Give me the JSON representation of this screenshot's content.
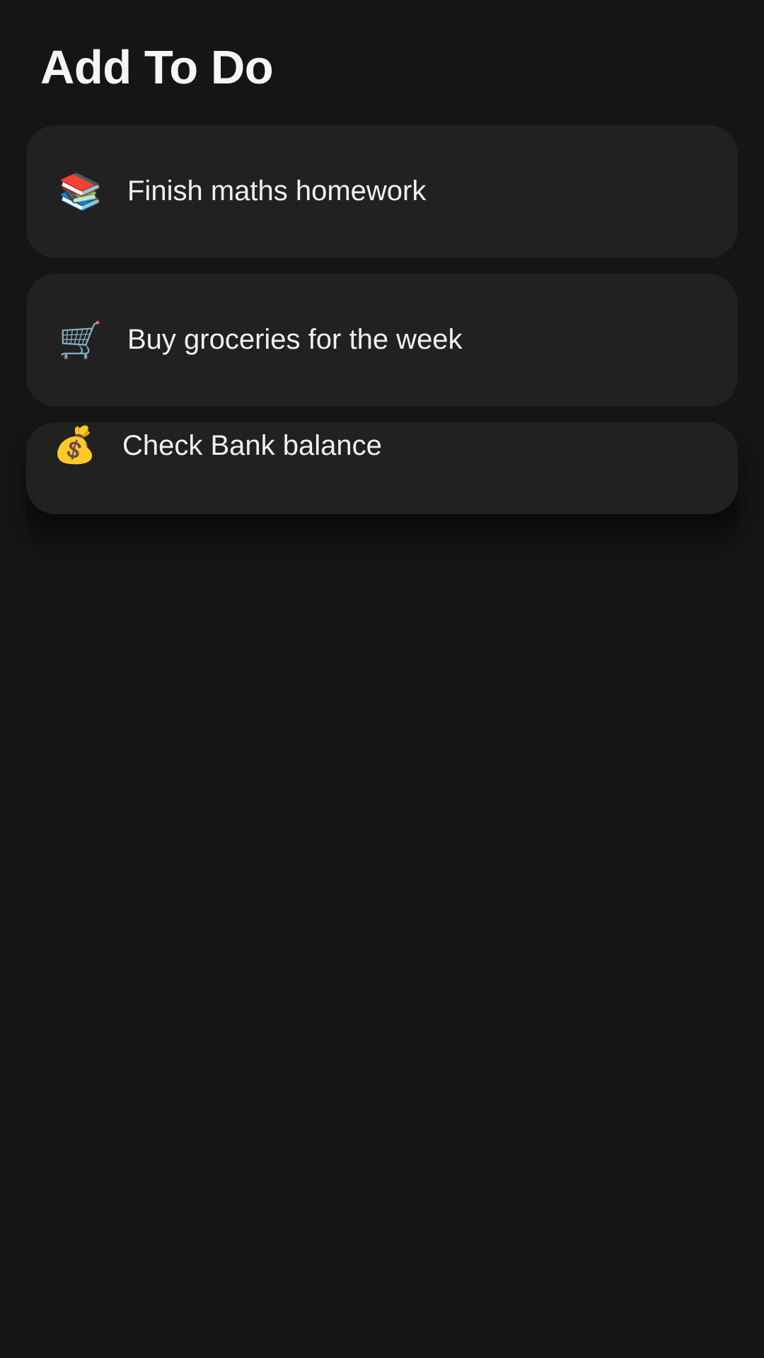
{
  "header": {
    "title": "Add To Do"
  },
  "todos": [
    {
      "icon": "books-icon",
      "emoji": "📚",
      "label": "Finish maths homework"
    },
    {
      "icon": "shopping-cart-icon",
      "emoji": "🛒",
      "label": "Buy groceries for the week"
    },
    {
      "icon": "money-bag-icon",
      "emoji": "💰",
      "label": "Check Bank balance"
    }
  ],
  "colors": {
    "background": "#151515",
    "card": "#212121",
    "text": "#f0f0f0"
  }
}
